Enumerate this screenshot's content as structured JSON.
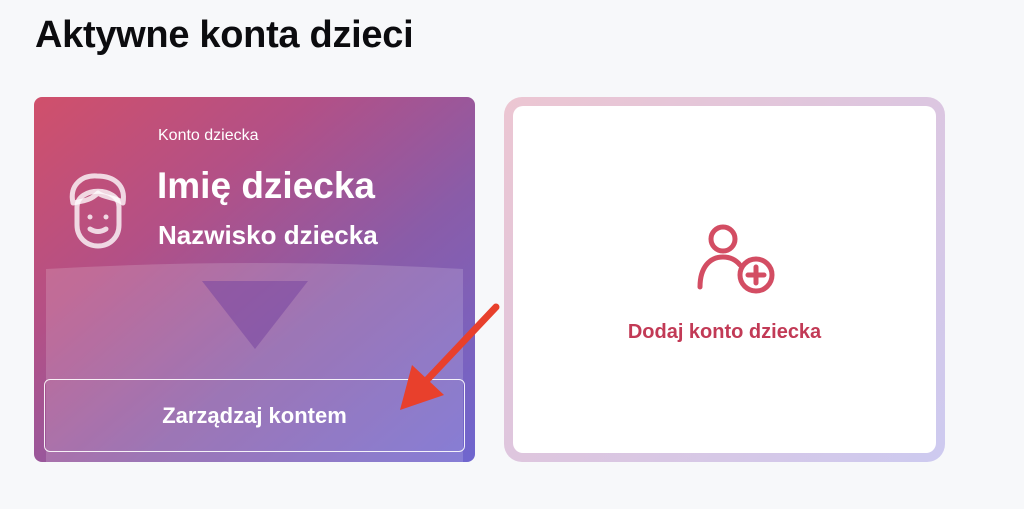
{
  "page": {
    "title": "Aktywne konta dzieci"
  },
  "child_card": {
    "eyebrow": "Konto dziecka",
    "first_name": "Imię dziecka",
    "last_name": "Nazwisko dziecka",
    "manage_button_label": "Zarządzaj kontem",
    "avatar_icon": "child-face-icon",
    "gradient_colors": [
      "#d0506b",
      "#8a5ca8",
      "#6f66cf"
    ]
  },
  "add_card": {
    "label": "Dodaj konto dziecka",
    "icon": "add-user-icon",
    "accent_color": "#c23a56"
  },
  "annotation": {
    "icon": "red-arrow",
    "color": "#e8402c"
  }
}
